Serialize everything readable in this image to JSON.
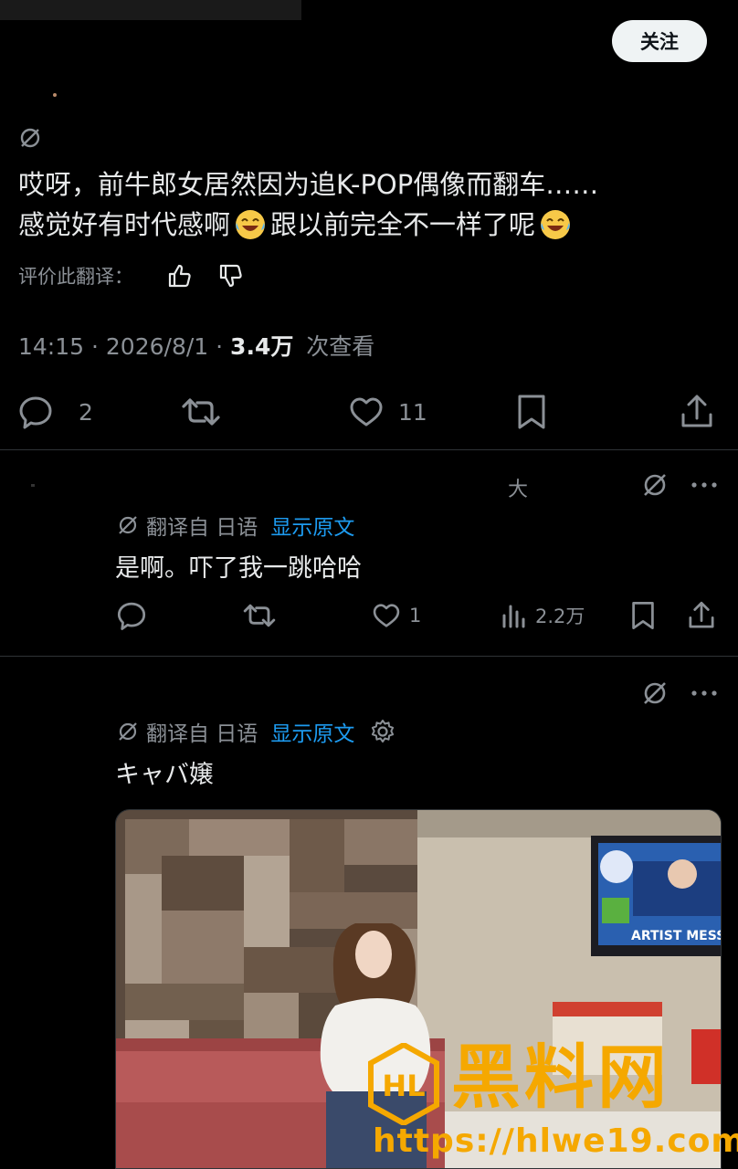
{
  "tweet": {
    "follow_label": "关注",
    "text_line1": "哎呀，前牛郎女居然因为追K-POP偶像而翻车……",
    "text_line2_a": "感觉好有时代感啊",
    "text_line2_b": " 跟以前完全不一样了呢",
    "rate_label": "评价此翻译：",
    "time": "14:15",
    "date": "2026/8/1",
    "views_count": "3.4万",
    "views_label": "次查看",
    "replies": "2",
    "likes": "11"
  },
  "reply1": {
    "corner_char": "大",
    "translated_from": "翻译自 日语",
    "show_original": "显示原文",
    "text": "是啊。吓了我一跳哈哈",
    "likes": "1",
    "views": "2.2万"
  },
  "reply2": {
    "translated_from": "翻译自 日语",
    "show_original": "显示原文",
    "text": "キャバ嬢"
  },
  "media": {
    "tv_caption": "ARTIST MESSA"
  },
  "watermark": {
    "title": "黑料网",
    "url": "https://hlwe19.com",
    "logo_text": "HL"
  },
  "colors": {
    "background": "#000000",
    "text": "#e7e9ea",
    "muted": "#8b9096",
    "link": "#1d9bf0",
    "watermark": "#f5a800"
  },
  "icons": [
    "no-translate-icon",
    "reply-icon",
    "retweet-icon",
    "like-icon",
    "bookmark-icon",
    "share-icon",
    "thumbs-up-icon",
    "thumbs-down-icon",
    "more-icon",
    "views-icon",
    "settings-icon"
  ]
}
